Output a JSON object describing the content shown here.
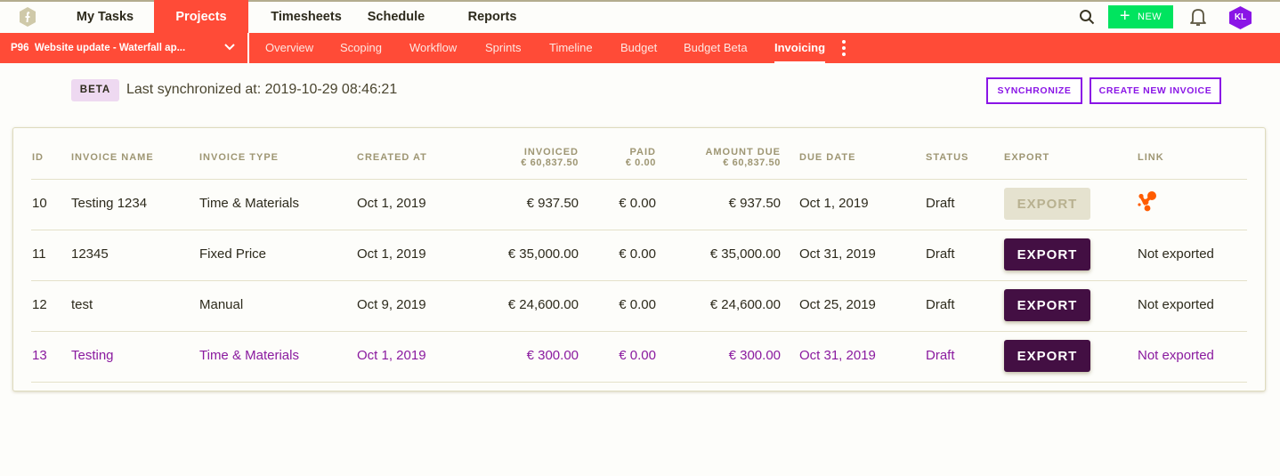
{
  "topnav": {
    "logo_icon": "hexagon-logo-icon",
    "items": [
      {
        "label": "My Tasks",
        "active": false
      },
      {
        "label": "Projects",
        "active": true
      },
      {
        "label": "Timesheets",
        "active": false
      },
      {
        "label": "Schedule",
        "active": false
      },
      {
        "label": "Reports",
        "active": false
      }
    ],
    "search_icon": "search-icon",
    "new_button": {
      "icon": "plus-icon",
      "label": "NEW"
    },
    "bell_icon": "bell-icon",
    "avatar_initials": "KL",
    "colors": {
      "accent": "#ff4b37",
      "new_button": "#00e45f",
      "avatar": "#8a15e6"
    }
  },
  "subnav": {
    "project": "P96  Website update - Waterfall ap...",
    "project_chevron": "chevron-down-icon",
    "tabs": [
      {
        "label": "Overview",
        "active": false
      },
      {
        "label": "Scoping",
        "active": false
      },
      {
        "label": "Workflow",
        "active": false
      },
      {
        "label": "Sprints",
        "active": false
      },
      {
        "label": "Timeline",
        "active": false
      },
      {
        "label": "Budget",
        "active": false
      },
      {
        "label": "Budget Beta",
        "active": false
      },
      {
        "label": "Invoicing",
        "active": true
      }
    ],
    "more_icon": "kebab-menu-icon"
  },
  "sync": {
    "badge": "BETA",
    "text": "Last synchronized at: 2019-10-29 08:46:21",
    "synchronize_label": "SYNCHRONIZE",
    "create_label": "CREATE NEW INVOICE"
  },
  "table": {
    "headers": {
      "id": "ID",
      "name": "INVOICE NAME",
      "type": "INVOICE TYPE",
      "created": "CREATED AT",
      "invoiced": "INVOICED",
      "invoiced_total": "€ 60,837.50",
      "paid": "PAID",
      "paid_total": "€ 0.00",
      "due": "AMOUNT DUE",
      "due_total": "€ 60,837.50",
      "due_date": "DUE DATE",
      "status": "STATUS",
      "export": "EXPORT",
      "link": "LINK"
    },
    "rows": [
      {
        "id": "10",
        "name": "Testing 1234",
        "type": "Time & Materials",
        "created": "Oct 1, 2019",
        "invoiced": "€ 937.50",
        "paid": "€ 0.00",
        "due": "€ 937.50",
        "due_date": "Oct 1, 2019",
        "status": "Draft",
        "export_label": "EXPORT",
        "export_enabled": false,
        "link": "",
        "link_icon": "integration-logo-icon",
        "highlighted": false
      },
      {
        "id": "11",
        "name": "12345",
        "type": "Fixed Price",
        "created": "Oct 1, 2019",
        "invoiced": "€ 35,000.00",
        "paid": "€ 0.00",
        "due": "€ 35,000.00",
        "due_date": "Oct 31, 2019",
        "status": "Draft",
        "export_label": "EXPORT",
        "export_enabled": true,
        "link": "Not exported",
        "highlighted": false
      },
      {
        "id": "12",
        "name": "test",
        "type": "Manual",
        "created": "Oct 9, 2019",
        "invoiced": "€ 24,600.00",
        "paid": "€ 0.00",
        "due": "€ 24,600.00",
        "due_date": "Oct 25, 2019",
        "status": "Draft",
        "export_label": "EXPORT",
        "export_enabled": true,
        "link": "Not exported",
        "highlighted": false
      },
      {
        "id": "13",
        "name": "Testing",
        "type": "Time & Materials",
        "created": "Oct 1, 2019",
        "invoiced": "€ 300.00",
        "paid": "€ 0.00",
        "due": "€ 300.00",
        "due_date": "Oct 31, 2019",
        "status": "Draft",
        "export_label": "EXPORT",
        "export_enabled": true,
        "link": "Not exported",
        "highlighted": true
      }
    ]
  }
}
